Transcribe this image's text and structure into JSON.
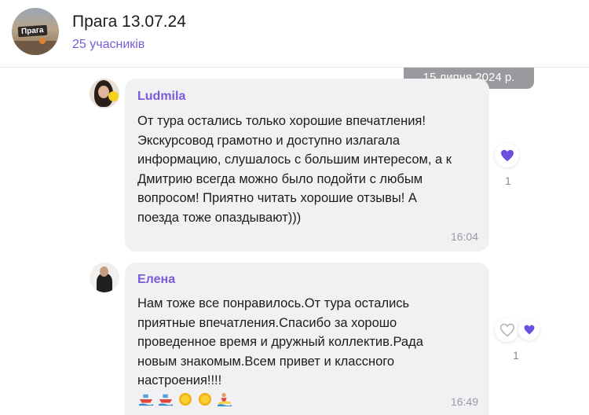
{
  "header": {
    "avatar_caption": "Прага",
    "title": "Прага 13.07.24",
    "subtitle": "25 учасників"
  },
  "date_chip": "15 липня 2024 р.",
  "messages": [
    {
      "sender": "Ludmila",
      "text": "От тура остались только хорошие впечатления!\nЭкскурсовод грамотно и доступно излагала\nинформацию, слушалось с большим интересом, а к\nДмитрию всегда можно было подойти с любым\nвопросом! Приятно читать хорошие отзывы! А\nпоезда тоже опаздывают)))",
      "time": "16:04",
      "reaction_count": "1"
    },
    {
      "sender": "Елена",
      "text": "Нам тоже все понравилось.От тура остались\nприятные впечатления.Спасибо за хорошо\nпроведенное время и дружный коллектив.Рада\nновым знакомым.Всем привет и классного\nнастроения!!!!",
      "emojis": [
        "ship-emoji",
        "ship-emoji",
        "sun-emoji",
        "sun-emoji",
        "surfer-emoji"
      ],
      "time": "16:49",
      "reaction_count": "1"
    }
  ],
  "colors": {
    "accent": "#7a5bd6",
    "bubble": "#f1f1f4",
    "date_chip": "#9a9a9e",
    "heart": "#6a4fe0"
  }
}
